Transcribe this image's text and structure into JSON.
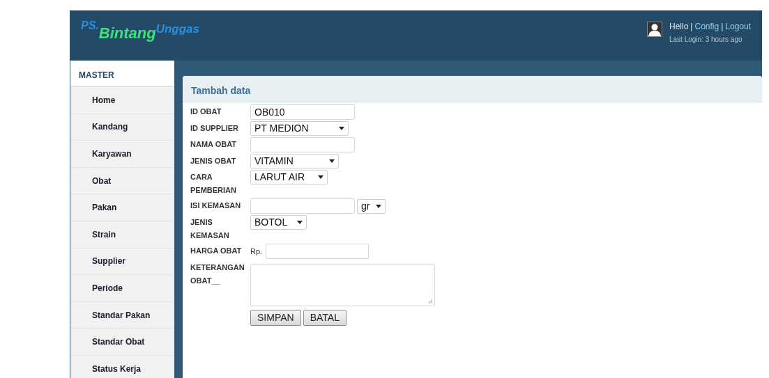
{
  "header": {
    "logo": {
      "prefix": "PS.",
      "main": "Bintang",
      "suffix": "Unggas"
    },
    "user": {
      "greeting": "Hello",
      "links": [
        "Config",
        "Logout"
      ],
      "separator": "|",
      "last_login": "Last Login: 3 hours ago"
    }
  },
  "sidebar": {
    "title": "MASTER",
    "items": [
      {
        "label": "Home",
        "selected": false
      },
      {
        "label": "Kandang",
        "selected": false
      },
      {
        "label": "Karyawan",
        "selected": false
      },
      {
        "label": "Obat",
        "selected": false
      },
      {
        "label": "Pakan",
        "selected": false
      },
      {
        "label": "Strain",
        "selected": false
      },
      {
        "label": "Supplier",
        "selected": false
      },
      {
        "label": "Periode",
        "selected": false
      },
      {
        "label": "Standar Pakan",
        "selected": false
      },
      {
        "label": "Standar Obat",
        "selected": false
      },
      {
        "label": "Status Kerja",
        "selected": false
      }
    ]
  },
  "panel": {
    "title": "Tambah data",
    "fields": [
      {
        "label": "ID OBAT",
        "kind": "text",
        "value": "OB010"
      },
      {
        "label": "ID SUPPLIER",
        "kind": "select",
        "value": "PT MEDION"
      },
      {
        "label": "NAMA OBAT",
        "kind": "text"
      },
      {
        "label": "JENIS OBAT",
        "kind": "select",
        "value": "VITAMIN"
      },
      {
        "label": "CARA PEMBERIAN",
        "kind": "select",
        "value": "LARUT AIR"
      },
      {
        "label": "ISI KEMASAN",
        "kind": "text_unit",
        "unit": "gr"
      },
      {
        "label": "JENIS KEMASAN",
        "kind": "select",
        "value": "BOTOL"
      },
      {
        "label": "HARGA OBAT",
        "kind": "currency",
        "prefix": "Rp."
      },
      {
        "label": "KETERANGAN OBAT__",
        "kind": "textarea"
      }
    ],
    "buttons": [
      "SIMPAN",
      "BATAL"
    ]
  }
}
